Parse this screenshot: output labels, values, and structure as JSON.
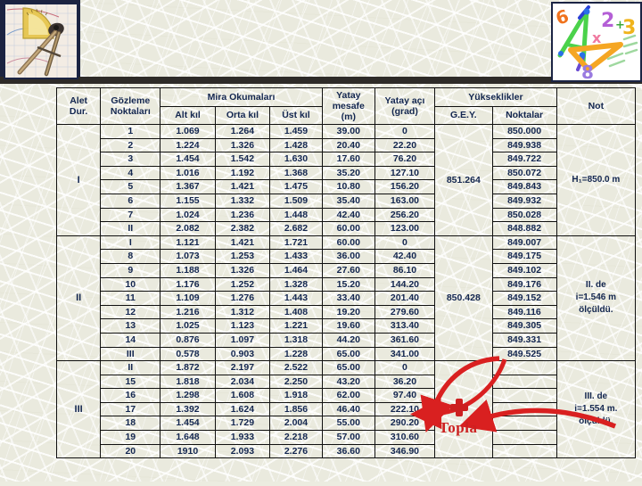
{
  "header": {
    "left_image": "compass-protractor-photo",
    "right_image": "geometry-tools-clipart"
  },
  "table": {
    "headers": {
      "alet_dur": "Alet Dur.",
      "gozleme_noktalari": "Gözleme Noktaları",
      "mira_okumalari": "Mira Okumaları",
      "alt_kil": "Alt kıl",
      "orta_kil": "Orta kıl",
      "ust_kil": "Üst kıl",
      "yatay_mesafe": "Yatay mesafe (m)",
      "yatay_mesafe_l1": "Yatay",
      "yatay_mesafe_l2": "mesafe",
      "yatay_mesafe_l3": "(m)",
      "yatay_aci": "Yatay açı (grad)",
      "yatay_aci_l1": "Yatay açı",
      "yatay_aci_l2": "(grad)",
      "yukseklikler": "Yükseklikler",
      "gey": "G.E.Y.",
      "noktalar": "Noktalar",
      "not": "Not"
    },
    "sections": [
      {
        "station": "I",
        "gey": "851.264",
        "note": "H₁=850.0 m",
        "rows": [
          {
            "point": "1",
            "alt": "1.069",
            "orta": "1.264",
            "ust": "1.459",
            "mesafe": "39.00",
            "aci": "0",
            "nokta": "850.000"
          },
          {
            "point": "2",
            "alt": "1.224",
            "orta": "1.326",
            "ust": "1.428",
            "mesafe": "20.40",
            "aci": "22.20",
            "nokta": "849.938"
          },
          {
            "point": "3",
            "alt": "1.454",
            "orta": "1.542",
            "ust": "1.630",
            "mesafe": "17.60",
            "aci": "76.20",
            "nokta": "849.722"
          },
          {
            "point": "4",
            "alt": "1.016",
            "orta": "1.192",
            "ust": "1.368",
            "mesafe": "35.20",
            "aci": "127.10",
            "nokta": "850.072"
          },
          {
            "point": "5",
            "alt": "1.367",
            "orta": "1.421",
            "ust": "1.475",
            "mesafe": "10.80",
            "aci": "156.20",
            "nokta": "849.843"
          },
          {
            "point": "6",
            "alt": "1.155",
            "orta": "1.332",
            "ust": "1.509",
            "mesafe": "35.40",
            "aci": "163.00",
            "nokta": "849.932"
          },
          {
            "point": "7",
            "alt": "1.024",
            "orta": "1.236",
            "ust": "1.448",
            "mesafe": "42.40",
            "aci": "256.20",
            "nokta": "850.028"
          },
          {
            "point": "II",
            "alt": "2.082",
            "orta": "2.382",
            "ust": "2.682",
            "mesafe": "60.00",
            "aci": "123.00",
            "nokta": "848.882"
          }
        ]
      },
      {
        "station": "II",
        "gey": "850.428",
        "note": "II. de i=1.546 m ölçüldü.",
        "note_lines": [
          "II. de",
          "i=1.546 m",
          "ölçüldü."
        ],
        "rows": [
          {
            "point": "I",
            "alt": "1.121",
            "orta": "1.421",
            "ust": "1.721",
            "mesafe": "60.00",
            "aci": "0",
            "nokta": "849.007"
          },
          {
            "point": "8",
            "alt": "1.073",
            "orta": "1.253",
            "ust": "1.433",
            "mesafe": "36.00",
            "aci": "42.40",
            "nokta": "849.175"
          },
          {
            "point": "9",
            "alt": "1.188",
            "orta": "1.326",
            "ust": "1.464",
            "mesafe": "27.60",
            "aci": "86.10",
            "nokta": "849.102"
          },
          {
            "point": "10",
            "alt": "1.176",
            "orta": "1.252",
            "ust": "1.328",
            "mesafe": "15.20",
            "aci": "144.20",
            "nokta": "849.176"
          },
          {
            "point": "11",
            "alt": "1.109",
            "orta": "1.276",
            "ust": "1.443",
            "mesafe": "33.40",
            "aci": "201.40",
            "nokta": "849.152"
          },
          {
            "point": "12",
            "alt": "1.216",
            "orta": "1.312",
            "ust": "1.408",
            "mesafe": "19.20",
            "aci": "279.60",
            "nokta": "849.116"
          },
          {
            "point": "13",
            "alt": "1.025",
            "orta": "1.123",
            "ust": "1.221",
            "mesafe": "19.60",
            "aci": "313.40",
            "nokta": "849.305"
          },
          {
            "point": "14",
            "alt": "0.876",
            "orta": "1.097",
            "ust": "1.318",
            "mesafe": "44.20",
            "aci": "361.60",
            "nokta": "849.331"
          },
          {
            "point": "III",
            "alt": "0.578",
            "orta": "0.903",
            "ust": "1.228",
            "mesafe": "65.00",
            "aci": "341.00",
            "nokta": "849.525"
          }
        ]
      },
      {
        "station": "III",
        "gey": "",
        "note": "III. de i=1.554 m. ölçüldü.",
        "note_lines": [
          "III. de",
          "i=1.554 m.",
          "ölçüldü."
        ],
        "rows": [
          {
            "point": "II",
            "alt": "1.872",
            "orta": "2.197",
            "ust": "2.522",
            "mesafe": "65.00",
            "aci": "0",
            "nokta": ""
          },
          {
            "point": "15",
            "alt": "1.818",
            "orta": "2.034",
            "ust": "2.250",
            "mesafe": "43.20",
            "aci": "36.20",
            "nokta": ""
          },
          {
            "point": "16",
            "alt": "1.298",
            "orta": "1.608",
            "ust": "1.918",
            "mesafe": "62.00",
            "aci": "97.40",
            "nokta": ""
          },
          {
            "point": "17",
            "alt": "1.392",
            "orta": "1.624",
            "ust": "1.856",
            "mesafe": "46.40",
            "aci": "222.10",
            "nokta": ""
          },
          {
            "point": "18",
            "alt": "1.454",
            "orta": "1.729",
            "ust": "2.004",
            "mesafe": "55.00",
            "aci": "290.20",
            "nokta": ""
          },
          {
            "point": "19",
            "alt": "1.648",
            "orta": "1.933",
            "ust": "2.218",
            "mesafe": "57.00",
            "aci": "310.60",
            "nokta": ""
          },
          {
            "point": "20",
            "alt": "1910",
            "orta": "2.093",
            "ust": "2.276",
            "mesafe": "36.60",
            "aci": "346.90",
            "nokta": ""
          }
        ]
      }
    ]
  },
  "annotation": {
    "topla_label": "Topla",
    "plus_icon": "red-plus-icon",
    "accent_color": "#cc2020",
    "text_color": "#13264f"
  }
}
